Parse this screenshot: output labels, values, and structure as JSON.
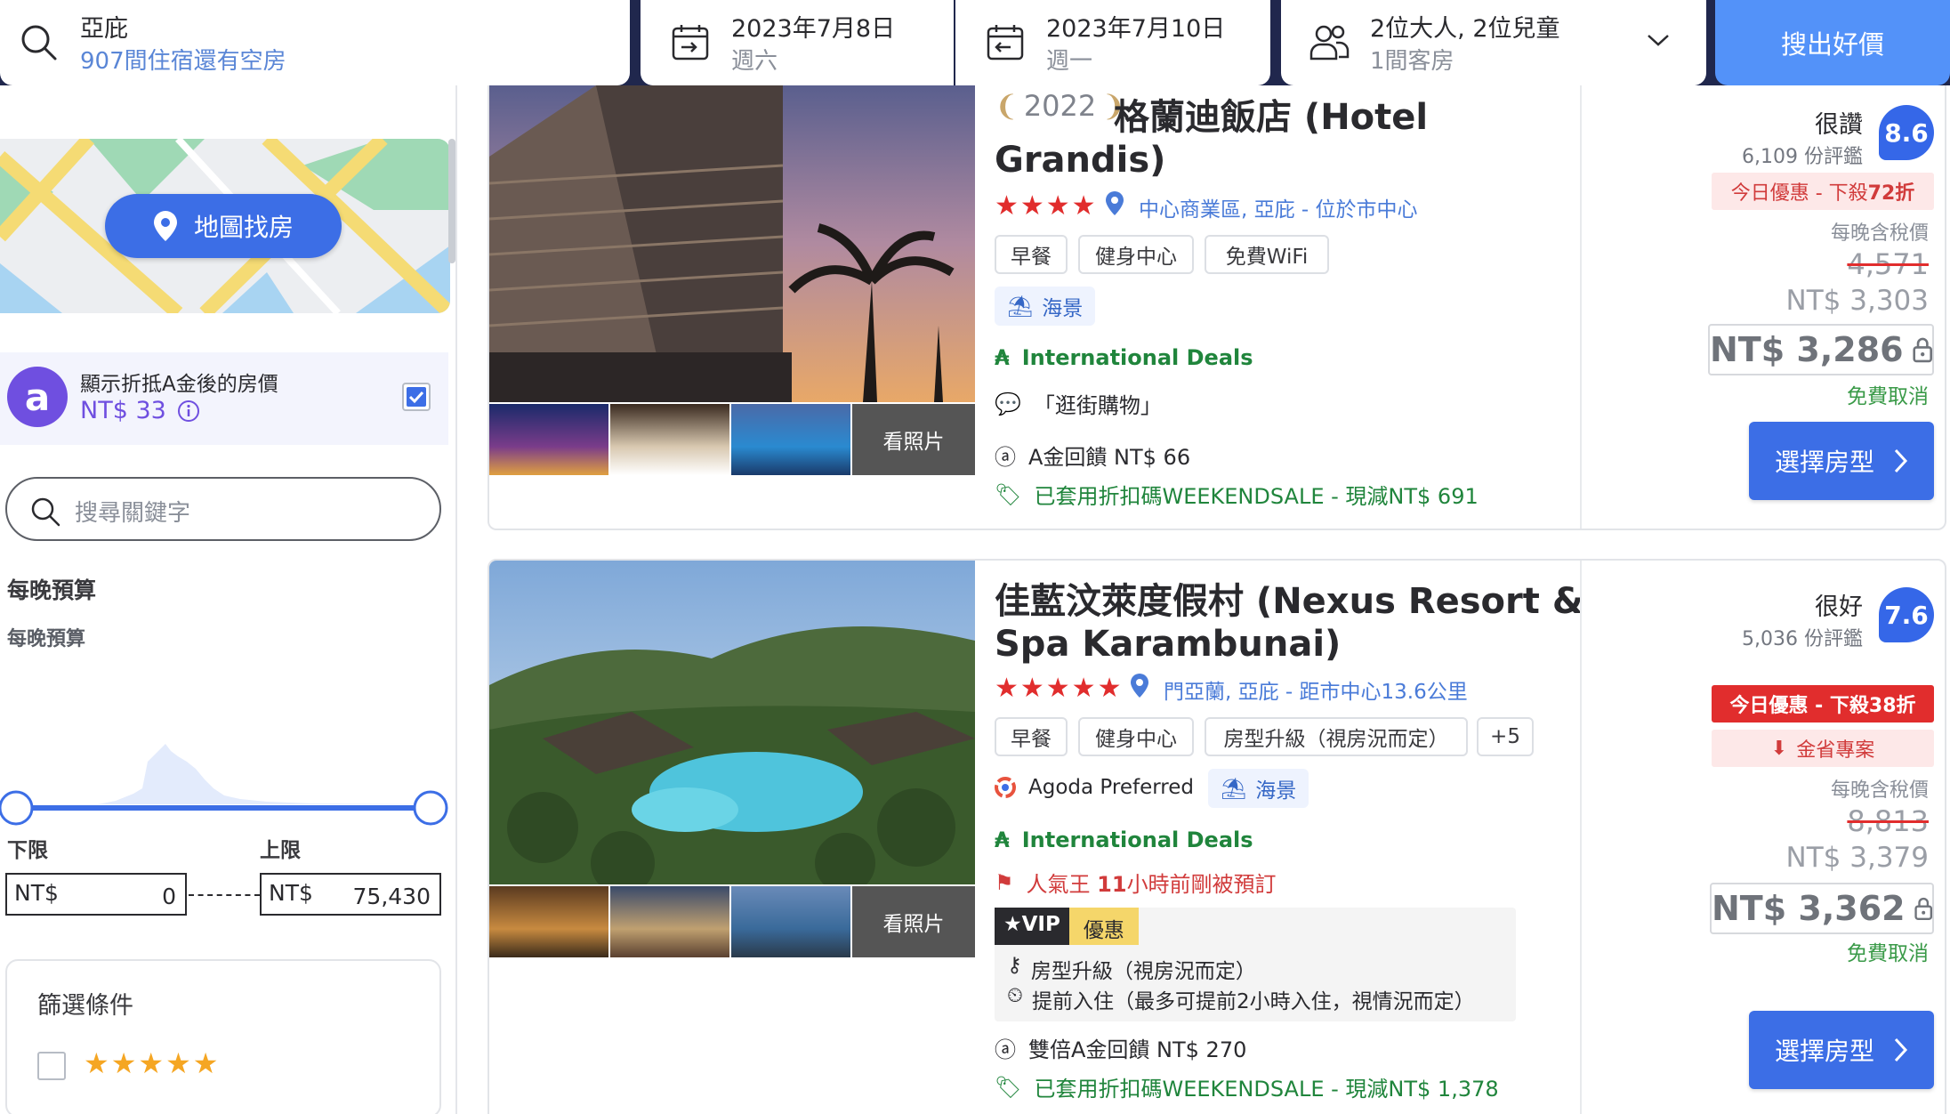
{
  "topbar": {
    "destination": "亞庇",
    "availability": "907間住宿還有空房",
    "checkin_date": "2023年7月8日",
    "checkin_day": "週六",
    "checkout_date": "2023年7月10日",
    "checkout_day": "週一",
    "guests": "2位大人, 2位兒童",
    "rooms": "1間客房",
    "search_label": "搜出好價"
  },
  "sidebar": {
    "map_button": "地圖找房",
    "acash_label": "顯示折抵A金後的房價",
    "acash_value": "NT$ 33",
    "keyword_placeholder": "搜尋關鍵字",
    "budget_title": "每晚預算",
    "budget_subtitle": "每晚預算",
    "min_label": "下限",
    "max_label": "上限",
    "currency": "NT$",
    "min_value": "0",
    "max_value": "75,430",
    "filter_title": "篩選條件",
    "filter_stars": "★★★★★"
  },
  "hotels": [
    {
      "award": "2022",
      "name_line1": "格蘭迪飯店 (Hotel",
      "name_line2": "Grandis)",
      "stars": "★★★★",
      "location": "中心商業區, 亞庇 - 位於市中心",
      "tags": [
        "早餐",
        "健身中心",
        "免費WiFi"
      ],
      "seaview": "海景",
      "intl_deals": "International Deals",
      "review_quote": "「逛街購物」",
      "cashback": "A金回饋 NT$ 66",
      "coupon": "已套用折扣碼WEEKENDSALE - 現減NT$ 691",
      "more_photos": "看照片",
      "rating_word": "很讚",
      "reviews": "6,109 份評鑑",
      "score": "8.6",
      "deal": "今日優惠 - 下殺",
      "deal_pct": "72折",
      "per_night": "每晚含稅價",
      "original_price": "4,571",
      "mid_price": "NT$ 3,303",
      "final_price": "NT$ 3,286",
      "free_cancel": "免費取消",
      "select": "選擇房型"
    },
    {
      "name_line1": "佳藍汶萊度假村 (Nexus Resort &",
      "name_line2": "Spa Karambunai)",
      "stars": "★★★★★",
      "location": "門亞蘭, 亞庇 - 距市中心13.6公里",
      "tags": [
        "早餐",
        "健身中心",
        "房型升級（視房況而定）",
        "+5"
      ],
      "preferred": "Agoda Preferred",
      "seaview": "海景",
      "intl_deals": "International Deals",
      "popular_prefix": "人氣王 ",
      "popular_hours": "11",
      "popular_suffix": "小時前剛被預訂",
      "vip": "VIP",
      "vip_deal": "優惠",
      "vip_perk1": "房型升級（視房況而定）",
      "vip_perk2": "提前入住（最多可提前2小時入住，視情況而定）",
      "cashback": "雙倍A金回饋 NT$ 270",
      "coupon": "已套用折扣碼WEEKENDSALE - 現減NT$ 1,378",
      "more_photos": "看照片",
      "rating_word": "很好",
      "reviews": "5,036 份評鑑",
      "score": "7.6",
      "deal": "今日優惠 - 下殺38折",
      "savings": "金省專案",
      "per_night": "每晚含稅價",
      "original_price": "8,813",
      "mid_price": "NT$ 3,379",
      "final_price": "NT$ 3,362",
      "free_cancel": "免費取消",
      "select": "選擇房型"
    }
  ],
  "colors": {
    "brand_blue": "#5392f9",
    "nav_dark": "#20274d",
    "deal_red": "#e12d2d",
    "cancel_green": "#3a9a48"
  }
}
